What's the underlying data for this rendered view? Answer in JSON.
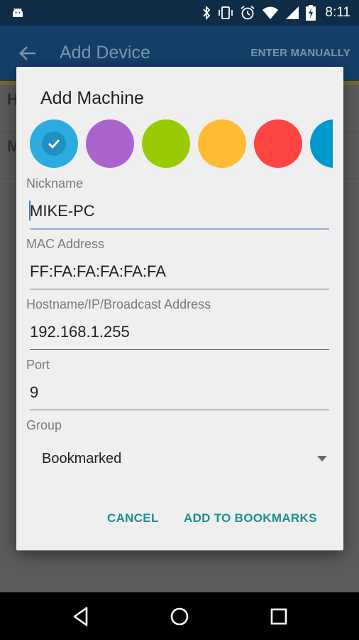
{
  "status_bar": {
    "time": "8:11",
    "icons": [
      "android-debug-icon",
      "bluetooth-icon",
      "vibrate-icon",
      "alarm-icon",
      "wifi-icon",
      "signal-icon",
      "battery-charging-icon"
    ]
  },
  "app_bar": {
    "title": "Add Device",
    "action_label": "ENTER MANUALLY",
    "back_icon": "arrow-back-icon",
    "background_color": "#133f67",
    "accent_color": "#7d6a1f"
  },
  "background_list": {
    "items": [
      {
        "initial": "H"
      },
      {
        "initial": "M"
      }
    ]
  },
  "dialog": {
    "title": "Add Machine",
    "colors": [
      {
        "hex": "#2cabe0",
        "selected": true
      },
      {
        "hex": "#ab63cd",
        "selected": false
      },
      {
        "hex": "#99cc00",
        "selected": false
      },
      {
        "hex": "#ffbb33",
        "selected": false
      },
      {
        "hex": "#ff4444",
        "selected": false
      },
      {
        "hex": "#0099cc",
        "selected": false
      }
    ],
    "nickname": {
      "label": "Nickname",
      "value": "MIKE-PC"
    },
    "mac": {
      "label": "MAC Address",
      "value": "FF:FA:FA:FA:FA:FA"
    },
    "host": {
      "label": "Hostname/IP/Broadcast Address",
      "value": "192.168.1.255"
    },
    "port": {
      "label": "Port",
      "value": "9"
    },
    "group": {
      "label": "Group",
      "value": "Bookmarked"
    },
    "buttons": {
      "cancel": "CANCEL",
      "confirm": "ADD TO BOOKMARKS"
    },
    "button_color": "#1c8f8f"
  },
  "nav_bar": {
    "icons": [
      "back-triangle-icon",
      "home-circle-icon",
      "recents-square-icon"
    ]
  }
}
